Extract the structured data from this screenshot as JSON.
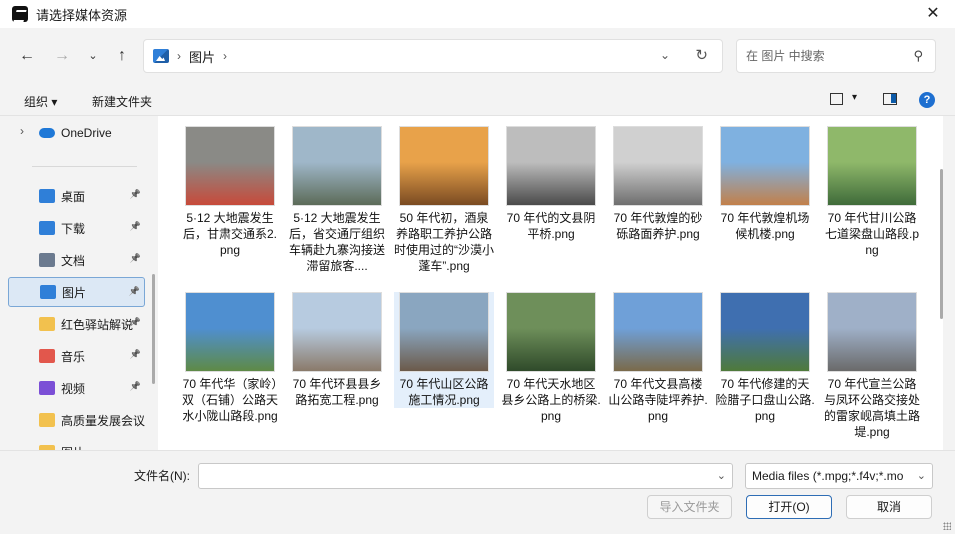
{
  "window": {
    "title": "请选择媒体资源",
    "close_glyph": "✕"
  },
  "navigation": {
    "back_icon": "arrow-left-icon",
    "forward_icon": "arrow-right-icon",
    "history_icon": "chevron-down-icon",
    "up_icon": "arrow-up-icon",
    "breadcrumb": [
      "图片"
    ],
    "search_placeholder": "在 图片 中搜索"
  },
  "toolbar": {
    "organize_label": "组织 ▾",
    "new_folder_label": "新建文件夹",
    "help_glyph": "?"
  },
  "sidebar": {
    "onedrive": "OneDrive",
    "items": [
      {
        "label": "桌面",
        "icon": "desktop-icon",
        "color": "#2f7fd8",
        "pinned": true,
        "selected": false
      },
      {
        "label": "下载",
        "icon": "download-icon",
        "color": "#2f7fd8",
        "pinned": true,
        "selected": false
      },
      {
        "label": "文档",
        "icon": "document-icon",
        "color": "#6b7a8f",
        "pinned": true,
        "selected": false
      },
      {
        "label": "图片",
        "icon": "pictures-icon",
        "color": "#2f7fd8",
        "pinned": true,
        "selected": true
      },
      {
        "label": "红色驿站解说",
        "icon": "folder-icon",
        "color": "#f2c14e",
        "pinned": true,
        "selected": false
      },
      {
        "label": "音乐",
        "icon": "music-icon",
        "color": "#e2574c",
        "pinned": true,
        "selected": false
      },
      {
        "label": "视频",
        "icon": "video-icon",
        "color": "#7b4fd6",
        "pinned": true,
        "selected": false
      },
      {
        "label": "高质量发展会议",
        "icon": "folder-icon",
        "color": "#f2c14e",
        "pinned": false,
        "selected": false
      },
      {
        "label": "图片",
        "icon": "folder-icon",
        "color": "#f2c14e",
        "pinned": false,
        "selected": false
      }
    ]
  },
  "files": [
    {
      "name": "5·12 大地震发生后，甘肃交通系2.png",
      "thumb": [
        "#8a8a86",
        "#c74a3a"
      ],
      "selected": false
    },
    {
      "name": "5·12 大地震发生后，省交通厅组织车辆赴九寨沟接送滞留旅客....",
      "thumb": [
        "#9fb7c9",
        "#5c6b58"
      ],
      "selected": false
    },
    {
      "name": "50 年代初，酒泉养路职工养护公路时使用过的“沙漠小蓬车”.png",
      "thumb": [
        "#e8a24a",
        "#7a4b22"
      ],
      "selected": false
    },
    {
      "name": "70 年代的文县阴平桥.png",
      "thumb": [
        "#bdbdbd",
        "#4a4a4a"
      ],
      "selected": false
    },
    {
      "name": "70 年代敦煌的砂砾路面养护.png",
      "thumb": [
        "#d0d0d0",
        "#6e6e6e"
      ],
      "selected": false
    },
    {
      "name": "70 年代敦煌机场候机楼.png",
      "thumb": [
        "#7fb1e0",
        "#c2804a"
      ],
      "selected": false
    },
    {
      "name": "70 年代甘川公路七道梁盘山路段.png",
      "thumb": [
        "#8fb86a",
        "#3f6b3a"
      ],
      "selected": false
    },
    {
      "name": "70 年代华（家岭）双（石铺）公路天水小陇山路段.png",
      "thumb": [
        "#4f8fd0",
        "#5e8a46"
      ],
      "selected": false
    },
    {
      "name": "70 年代环县县乡路拓宽工程.png",
      "thumb": [
        "#b7cbe0",
        "#8a7a6a"
      ],
      "selected": false
    },
    {
      "name": "70 年代山区公路施工情况.png",
      "thumb": [
        "#8aa6c0",
        "#6b5a4a"
      ],
      "selected": true
    },
    {
      "name": "70 年代天水地区县乡公路上的桥梁.png",
      "thumb": [
        "#6e8f5a",
        "#2f4a2a"
      ],
      "selected": false
    },
    {
      "name": "70 年代文县高楼山公路寺陡坪养护.png",
      "thumb": [
        "#6fa0d8",
        "#7a6a4a"
      ],
      "selected": false
    },
    {
      "name": "70 年代修建的天险腊子口盘山公路.png",
      "thumb": [
        "#3f6fb0",
        "#4f7a3a"
      ],
      "selected": false
    },
    {
      "name": "70 年代宣兰公路与凤环公路交接处的雷家岘高填土路堤.png",
      "thumb": [
        "#9fb0c8",
        "#6a6a6a"
      ],
      "selected": false
    }
  ],
  "footer": {
    "filename_label": "文件名(N):",
    "filename_value": "",
    "filetype": "Media files (*.mpg;*.f4v;*.mo",
    "import_folder_label": "导入文件夹",
    "open_label": "打开(O)",
    "cancel_label": "取消"
  }
}
